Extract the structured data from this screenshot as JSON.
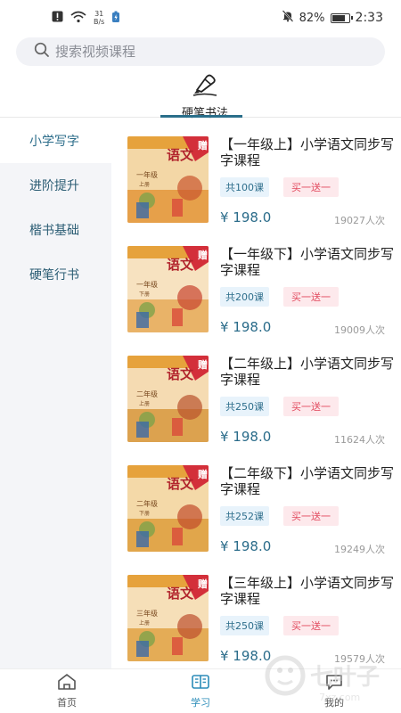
{
  "status": {
    "speed_value": "31",
    "speed_unit": "B/s",
    "battery": "82%",
    "battery_level": 0.82,
    "time": "2:33"
  },
  "search": {
    "placeholder": "搜索视频课程"
  },
  "category": {
    "icon": "pen-icon",
    "label": "硬笔书法"
  },
  "sidebar": {
    "items": [
      {
        "label": "小学写字",
        "active": true
      },
      {
        "label": "进阶提升",
        "active": false
      },
      {
        "label": "楷书基础",
        "active": false
      },
      {
        "label": "硬笔行书",
        "active": false
      }
    ]
  },
  "courses": [
    {
      "title": "【一年级上】小学语文同步写字课程",
      "lessons": "共100课",
      "promo": "买一送一",
      "price": "¥ 198.0",
      "learners": "19027人次",
      "cover_grade": "一年级",
      "cover_term": "上册",
      "cover_badge": "赠",
      "cover_subject": "语文"
    },
    {
      "title": "【一年级下】小学语文同步写字课程",
      "lessons": "共200课",
      "promo": "买一送一",
      "price": "¥ 198.0",
      "learners": "19009人次",
      "cover_grade": "一年级",
      "cover_term": "下册",
      "cover_badge": "赠",
      "cover_subject": "语文"
    },
    {
      "title": "【二年级上】小学语文同步写字课程",
      "lessons": "共250课",
      "promo": "买一送一",
      "price": "¥ 198.0",
      "learners": "11624人次",
      "cover_grade": "二年级",
      "cover_term": "上册",
      "cover_badge": "赠",
      "cover_subject": "语文"
    },
    {
      "title": "【二年级下】小学语文同步写字课程",
      "lessons": "共252课",
      "promo": "买一送一",
      "price": "¥ 198.0",
      "learners": "19249人次",
      "cover_grade": "二年级",
      "cover_term": "下册",
      "cover_badge": "赠",
      "cover_subject": "语文"
    },
    {
      "title": "【三年级上】小学语文同步写字课程",
      "lessons": "共250课",
      "promo": "买一送一",
      "price": "¥ 198.0",
      "learners": "19579人次",
      "cover_grade": "三年级",
      "cover_term": "上册",
      "cover_badge": "赠",
      "cover_subject": "语文"
    }
  ],
  "nav": {
    "home": "首页",
    "study": "学习",
    "mine": "我的"
  },
  "watermark": {
    "text": "七叶子",
    "sub": "7xz.com"
  },
  "colors": {
    "accent": "#2b6c8a",
    "promo": "#e24a5e",
    "lessons_bg": "#e8f3fb"
  }
}
